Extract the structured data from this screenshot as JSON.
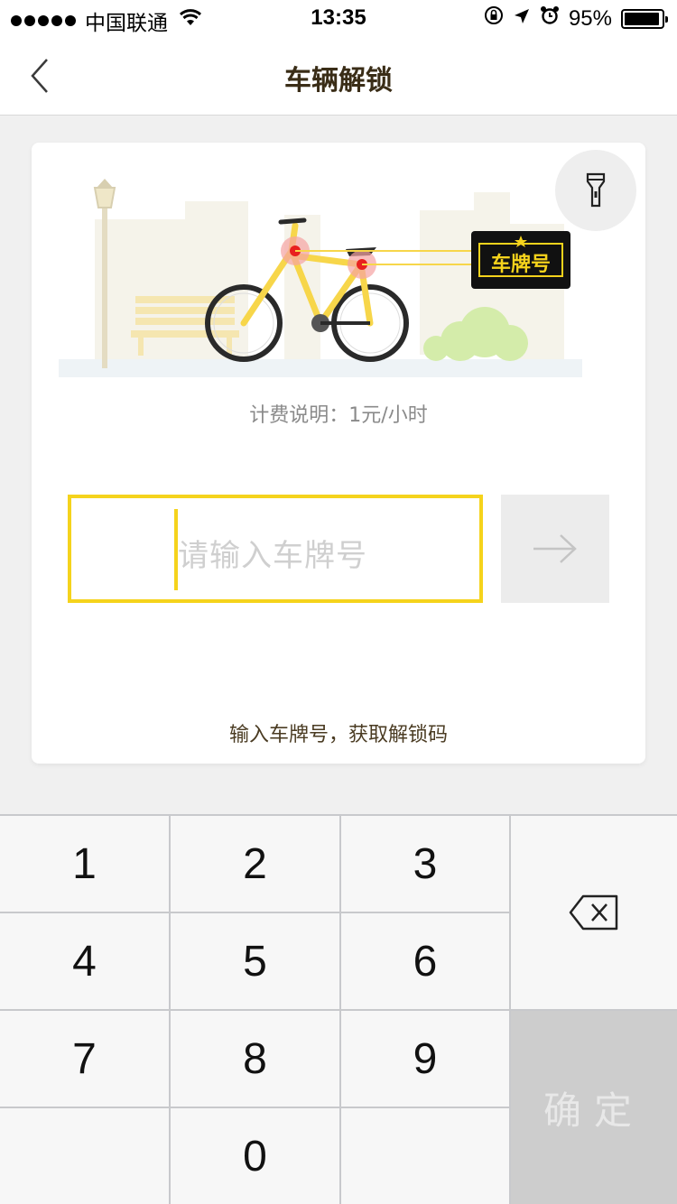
{
  "status_bar": {
    "carrier": "中国联通",
    "time": "13:35",
    "battery_text": "95%",
    "battery_level": 0.95
  },
  "nav": {
    "title": "车辆解锁"
  },
  "card": {
    "plate_sign": "车牌号",
    "billing_text": "计费说明：1元/小时",
    "input_placeholder": "请输入车牌号",
    "hint": "输入车牌号，获取解锁码"
  },
  "keyboard": {
    "keys": [
      "1",
      "2",
      "3",
      "4",
      "5",
      "6",
      "7",
      "8",
      "9",
      "0"
    ],
    "confirm_label": "确定"
  },
  "colors": {
    "accent": "#f5d31c",
    "bike_yellow": "#f7d64a",
    "text_dark": "#3a2d17"
  }
}
